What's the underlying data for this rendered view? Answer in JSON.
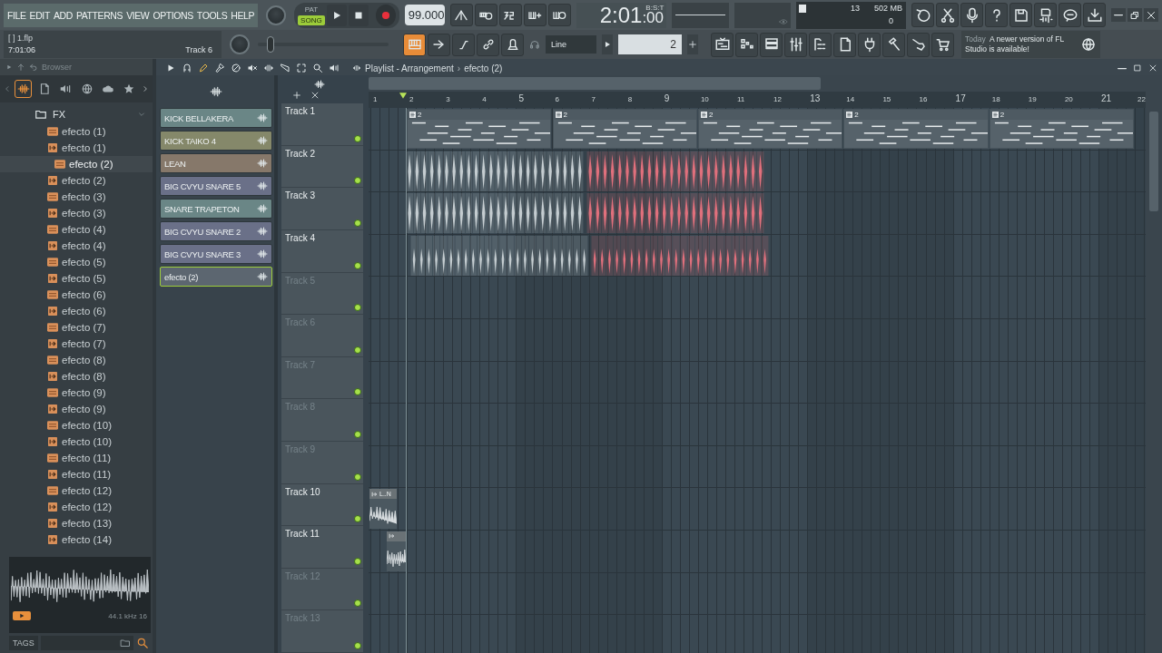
{
  "menu": [
    "FILE",
    "EDIT",
    "ADD",
    "PATTERNS",
    "VIEW",
    "OPTIONS",
    "TOOLS",
    "HELP"
  ],
  "transport": {
    "modes": [
      {
        "label": "PAT",
        "selected": false
      },
      {
        "label": "SONG",
        "selected": true
      }
    ]
  },
  "tempo": "99.000",
  "time": {
    "value": "2:01",
    "sub": ":00",
    "label": "B:S:T"
  },
  "memory": {
    "voices": "13",
    "ram": "502 MB",
    "cpu": "0"
  },
  "project": {
    "name": "[ ] 1.flp",
    "time": "7:01:06",
    "hint": "Track 6"
  },
  "snap": {
    "value": "Line"
  },
  "pattern_field": {
    "value": "2"
  },
  "news": {
    "label": "Today",
    "text": "A newer version of FL Studio is available!"
  },
  "browser": {
    "title": "Browser",
    "tabs": [
      {
        "kind": "waveform",
        "selected": true
      },
      {
        "kind": "document",
        "selected": false
      },
      {
        "kind": "speaker",
        "selected": false
      },
      {
        "kind": "globe",
        "selected": false
      },
      {
        "kind": "cloud",
        "selected": false
      },
      {
        "kind": "star",
        "selected": false
      }
    ],
    "tree": [
      {
        "label": "FX",
        "expanded": true,
        "children": [
          {
            "label": "efecto (1)",
            "kind": "mp3",
            "selected": false
          },
          {
            "label": "efecto (1)",
            "kind": "pattern",
            "selected": false
          },
          {
            "label": "efecto (2)",
            "kind": "mp3",
            "selected": true
          },
          {
            "label": "efecto (2)",
            "kind": "pattern",
            "selected": false
          },
          {
            "label": "efecto (3)",
            "kind": "mp3",
            "selected": false
          },
          {
            "label": "efecto (3)",
            "kind": "pattern",
            "selected": false
          },
          {
            "label": "efecto (4)",
            "kind": "mp3",
            "selected": false
          },
          {
            "label": "efecto (4)",
            "kind": "pattern",
            "selected": false
          },
          {
            "label": "efecto (5)",
            "kind": "mp3",
            "selected": false
          },
          {
            "label": "efecto (5)",
            "kind": "pattern",
            "selected": false
          },
          {
            "label": "efecto (6)",
            "kind": "mp3",
            "selected": false
          },
          {
            "label": "efecto (6)",
            "kind": "pattern",
            "selected": false
          },
          {
            "label": "efecto (7)",
            "kind": "mp3",
            "selected": false
          },
          {
            "label": "efecto (7)",
            "kind": "pattern",
            "selected": false
          },
          {
            "label": "efecto (8)",
            "kind": "mp3",
            "selected": false
          },
          {
            "label": "efecto (8)",
            "kind": "pattern",
            "selected": false
          },
          {
            "label": "efecto (9)",
            "kind": "mp3",
            "selected": false
          },
          {
            "label": "efecto (9)",
            "kind": "pattern",
            "selected": false
          },
          {
            "label": "efecto (10)",
            "kind": "mp3",
            "selected": false
          },
          {
            "label": "efecto (10)",
            "kind": "pattern",
            "selected": false
          },
          {
            "label": "efecto (11)",
            "kind": "mp3",
            "selected": false
          },
          {
            "label": "efecto (11)",
            "kind": "pattern",
            "selected": false
          },
          {
            "label": "efecto (12)",
            "kind": "mp3",
            "selected": false
          },
          {
            "label": "efecto (12)",
            "kind": "pattern",
            "selected": false
          },
          {
            "label": "efecto (13)",
            "kind": "pattern",
            "selected": false
          },
          {
            "label": "efecto (14)",
            "kind": "pattern",
            "selected": false
          }
        ]
      }
    ],
    "sample_info": "44.1 kHz 16",
    "tags_label": "TAGS"
  },
  "channels": [
    {
      "name": "KICK BELLAKERA",
      "color": "#6a8686",
      "selected": false
    },
    {
      "name": "KICK TAIKO 4",
      "color": "#85886a",
      "selected": false
    },
    {
      "name": "LEAN",
      "color": "#86786a",
      "selected": false
    },
    {
      "name": "BIG CVYU SNARE 5",
      "color": "#6a7088",
      "selected": false
    },
    {
      "name": "SNARE TRAPETON",
      "color": "#6a8686",
      "selected": false
    },
    {
      "name": "BIG CVYU SNARE 2",
      "color": "#6a7088",
      "selected": false
    },
    {
      "name": "BIG CVYU SNARE 3",
      "color": "#6a7088",
      "selected": false
    },
    {
      "name": "efecto (2)",
      "color": "#5c6670",
      "selected": true
    }
  ],
  "playlist": {
    "title": "Playlist - Arrangement",
    "separator": "›",
    "pattern": "efecto (2)",
    "ruler": [
      "1",
      "2",
      "3",
      "4",
      "5",
      "6",
      "7",
      "8",
      "9",
      "10",
      "11",
      "12",
      "13",
      "14",
      "15",
      "16",
      "17",
      "18",
      "19",
      "20",
      "21",
      "22"
    ],
    "tracks": [
      {
        "name": "Track 1",
        "dim": false,
        "clips": [
          {
            "kind": "pattern",
            "label": "2"
          },
          {
            "kind": "pattern",
            "label": "2"
          },
          {
            "kind": "pattern",
            "label": "2"
          },
          {
            "kind": "pattern",
            "label": "2"
          },
          {
            "kind": "pattern",
            "label": "2"
          }
        ]
      },
      {
        "name": "Track 2",
        "dim": false,
        "clips": [
          {
            "kind": "audio-run",
            "color": "#c4ccd0"
          },
          {
            "kind": "audio-run",
            "color": "#e0707c"
          }
        ]
      },
      {
        "name": "Track 3",
        "dim": false,
        "clips": [
          {
            "kind": "audio-run",
            "color": "#c4ccd0"
          },
          {
            "kind": "audio-run",
            "color": "#e0707c"
          }
        ]
      },
      {
        "name": "Track 4",
        "dim": false,
        "clips": [
          {
            "kind": "audio-run",
            "color": "#c4ccd0"
          },
          {
            "kind": "audio-run",
            "color": "#e0707c"
          }
        ]
      },
      {
        "name": "Track 5",
        "dim": true
      },
      {
        "name": "Track 6",
        "dim": true
      },
      {
        "name": "Track 7",
        "dim": true
      },
      {
        "name": "Track 8",
        "dim": true
      },
      {
        "name": "Track 9",
        "dim": true
      },
      {
        "name": "Track 10",
        "dim": false,
        "clips": [
          {
            "kind": "audio",
            "label": "L..N"
          }
        ]
      },
      {
        "name": "Track 11",
        "dim": false,
        "clips": [
          {
            "kind": "audio"
          }
        ]
      },
      {
        "name": "Track 12",
        "dim": true
      },
      {
        "name": "Track 13",
        "dim": true
      }
    ]
  }
}
